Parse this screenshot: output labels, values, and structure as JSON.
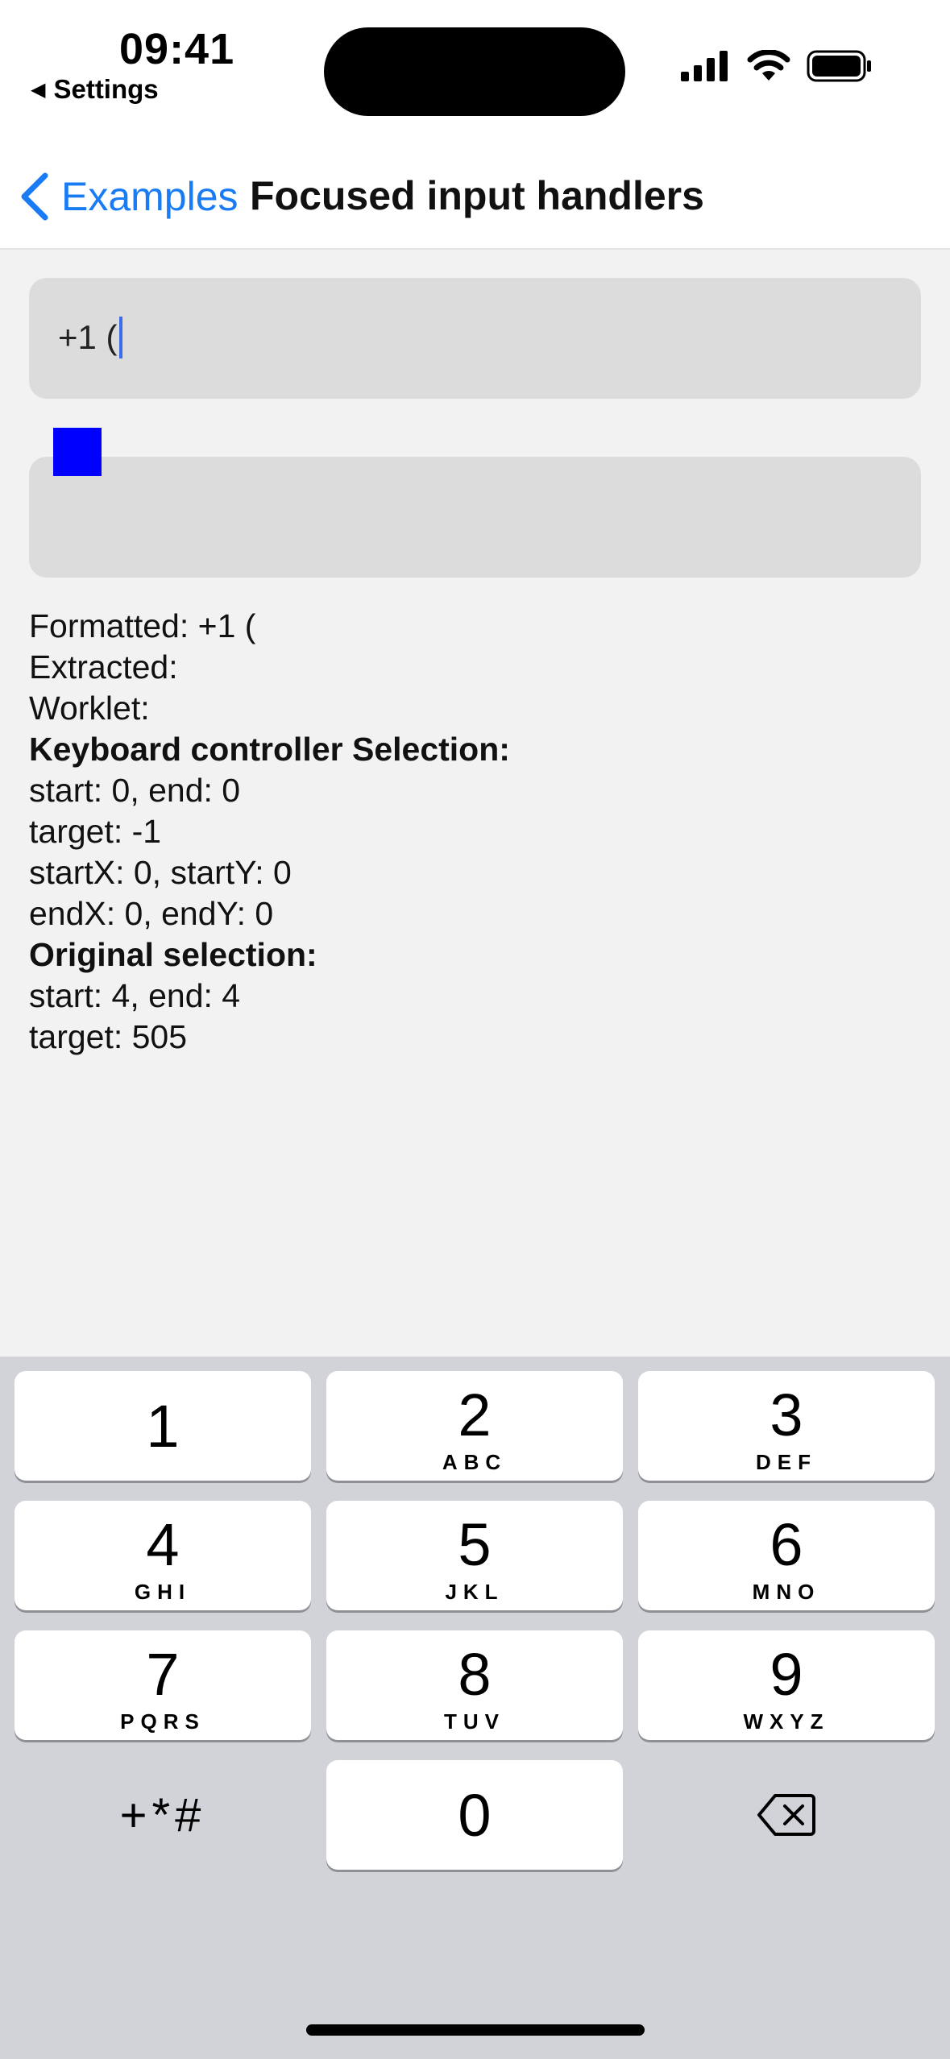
{
  "status_bar": {
    "time": "09:41",
    "back_app": "Settings",
    "icons": [
      "signal-icon",
      "wifi-icon",
      "battery-icon"
    ]
  },
  "nav": {
    "back_label": "Examples",
    "title": "Focused input handlers"
  },
  "inputs": {
    "phone_value": "+1 (",
    "second_value": ""
  },
  "info": {
    "formatted": "Formatted: +1 (",
    "extracted": "Extracted:",
    "worklet": "Worklet:",
    "kc_heading": "Keyboard controller Selection:",
    "kc_start_end": "start: 0, end: 0",
    "kc_target": "target: -1",
    "kc_start_xy": "startX: 0, startY: 0",
    "kc_end_xy": "endX: 0, endY: 0",
    "orig_heading": "Original selection:",
    "orig_start_end": "start: 4, end: 4",
    "orig_target": "target: 505"
  },
  "keypad": {
    "keys": [
      {
        "num": "1",
        "letters": ""
      },
      {
        "num": "2",
        "letters": "ABC"
      },
      {
        "num": "3",
        "letters": "DEF"
      },
      {
        "num": "4",
        "letters": "GHI"
      },
      {
        "num": "5",
        "letters": "JKL"
      },
      {
        "num": "6",
        "letters": "MNO"
      },
      {
        "num": "7",
        "letters": "PQRS"
      },
      {
        "num": "8",
        "letters": "TUV"
      },
      {
        "num": "9",
        "letters": "WXYZ"
      }
    ],
    "symbols": "+*#",
    "zero": "0"
  },
  "colors": {
    "accent": "#1a7cf5",
    "focus_square": "#0000ff",
    "keyboard_bg": "#d1d3d9",
    "field_bg": "#dcdcdc"
  }
}
